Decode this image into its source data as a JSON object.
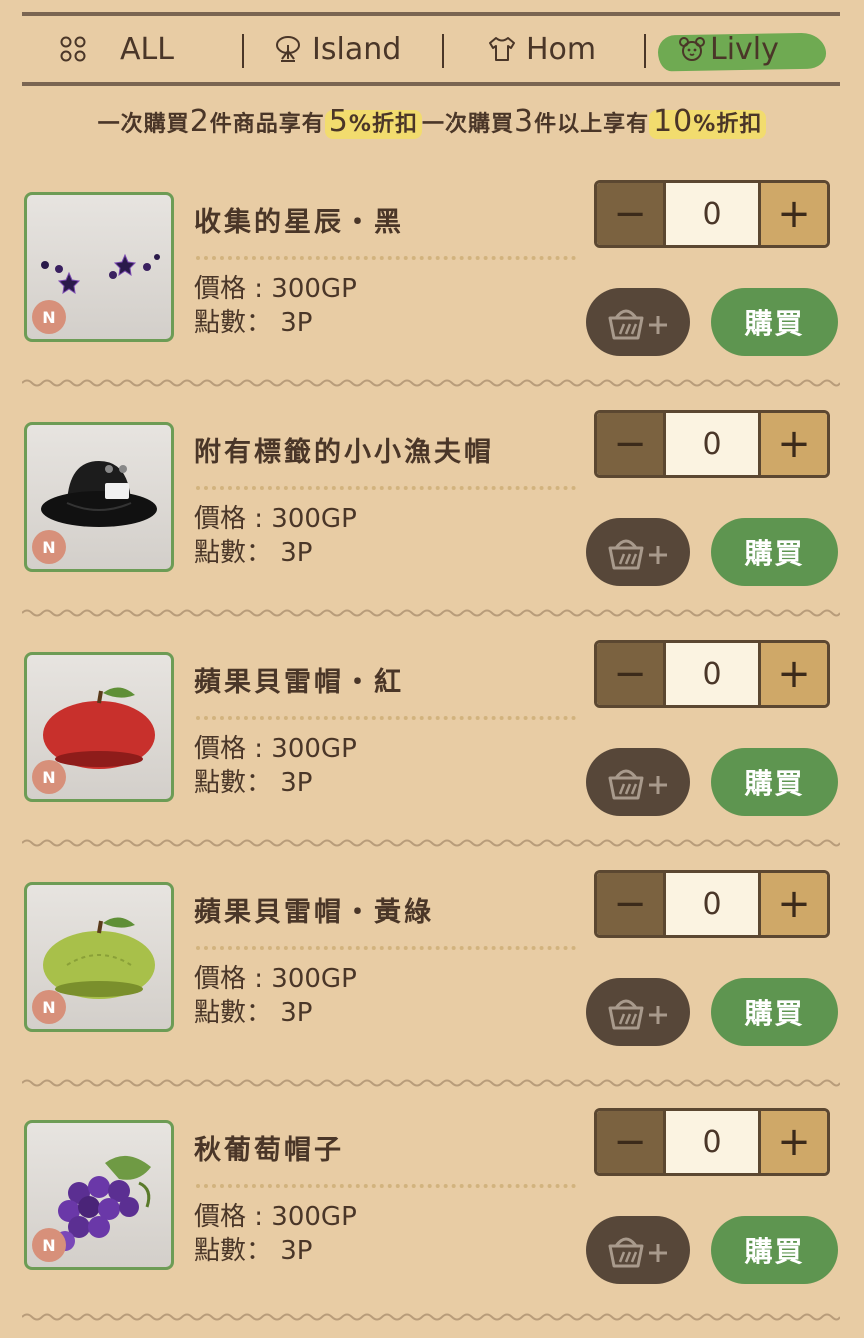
{
  "tabs": [
    {
      "label": "ALL",
      "icon": "grid-dots-icon"
    },
    {
      "label": "Island",
      "icon": "tree-icon"
    },
    {
      "label": "Hom",
      "icon": "shirt-icon"
    },
    {
      "label": "Livly",
      "icon": "livly-face-icon",
      "active": true
    }
  ],
  "promo": {
    "part1": "一次購買",
    "n1": "2",
    "part2": "件商品享有",
    "d1": "5",
    "d1_unit": "%",
    "part3": "折扣",
    "part4": "一次購買",
    "n2": "3",
    "part5": "件以上享有",
    "d2": "10",
    "d2_unit": "%",
    "part6": "折扣"
  },
  "items": [
    {
      "name": "收集的星辰・黑",
      "price": "價格 : 300GP",
      "points": "點數： 3P",
      "qty": "0",
      "rarity": "N",
      "buy": "購買",
      "thumb": "black-stars"
    },
    {
      "name": "附有標籤的小小漁夫帽",
      "price": "價格 : 300GP",
      "points": "點數： 3P",
      "qty": "0",
      "rarity": "N",
      "buy": "購買",
      "thumb": "black-bucket-hat"
    },
    {
      "name": "蘋果貝雷帽・紅",
      "price": "價格 : 300GP",
      "points": "點數： 3P",
      "qty": "0",
      "rarity": "N",
      "buy": "購買",
      "thumb": "red-apple-beret"
    },
    {
      "name": "蘋果貝雷帽・黃綠",
      "price": "價格 : 300GP",
      "points": "點數： 3P",
      "qty": "0",
      "rarity": "N",
      "buy": "購買",
      "thumb": "green-apple-beret"
    },
    {
      "name": "秋葡萄帽子",
      "price": "價格 : 300GP",
      "points": "點數： 3P",
      "qty": "0",
      "rarity": "N",
      "buy": "購買",
      "thumb": "grape-hat"
    }
  ],
  "colors": {
    "background": "#e8cca4",
    "buy_button": "#5e9550",
    "cart_button": "#574739",
    "highlight": "#f2dc6e",
    "active_tab": "#6faa52"
  }
}
